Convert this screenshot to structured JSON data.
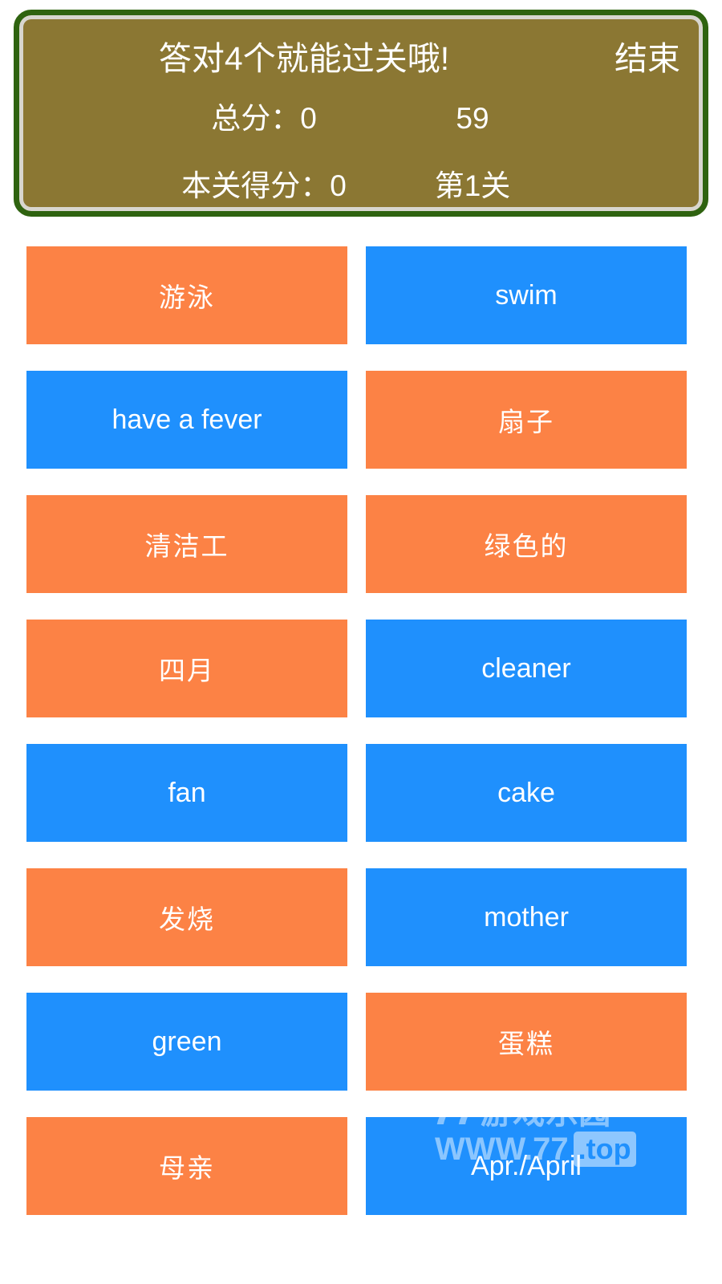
{
  "header": {
    "hint": "答对4个就能过关哦!",
    "end_button": "结束",
    "total_score_label": "总分：0",
    "timer": "59",
    "level_score_label": "本关得分：0",
    "level_label": "第1关",
    "panel_fill": "#8b7733",
    "panel_border": "#2f6310",
    "panel_inner_border": "#d8d6cf"
  },
  "colors": {
    "orange": "#fc8245",
    "blue": "#1f90fd",
    "tile_text": "#ffffff",
    "page_background": "#ffffff"
  },
  "tiles": {
    "rows": [
      {
        "left": {
          "label": "游泳",
          "color": "orange",
          "lang": "cn"
        },
        "right": {
          "label": "swim",
          "color": "blue",
          "lang": "en"
        }
      },
      {
        "left": {
          "label": "have a fever",
          "color": "blue",
          "lang": "en"
        },
        "right": {
          "label": "扇子",
          "color": "orange",
          "lang": "cn"
        }
      },
      {
        "left": {
          "label": "清洁工",
          "color": "orange",
          "lang": "cn"
        },
        "right": {
          "label": "绿色的",
          "color": "orange",
          "lang": "cn"
        }
      },
      {
        "left": {
          "label": "四月",
          "color": "orange",
          "lang": "cn"
        },
        "right": {
          "label": "cleaner",
          "color": "blue",
          "lang": "en"
        }
      },
      {
        "left": {
          "label": "fan",
          "color": "blue",
          "lang": "en"
        },
        "right": {
          "label": "cake",
          "color": "blue",
          "lang": "en"
        }
      },
      {
        "left": {
          "label": "发烧",
          "color": "orange",
          "lang": "cn"
        },
        "right": {
          "label": "mother",
          "color": "blue",
          "lang": "en"
        }
      },
      {
        "left": {
          "label": "green",
          "color": "blue",
          "lang": "en"
        },
        "right": {
          "label": "蛋糕",
          "color": "orange",
          "lang": "cn"
        }
      },
      {
        "left": {
          "label": "母亲",
          "color": "orange",
          "lang": "cn"
        },
        "right": {
          "label": "Apr./April",
          "color": "blue",
          "lang": "en"
        }
      }
    ]
  },
  "watermark": {
    "logo_number": "77",
    "logo_text": "游戏乐园",
    "url": "WWW.77",
    "tld": ".top"
  }
}
